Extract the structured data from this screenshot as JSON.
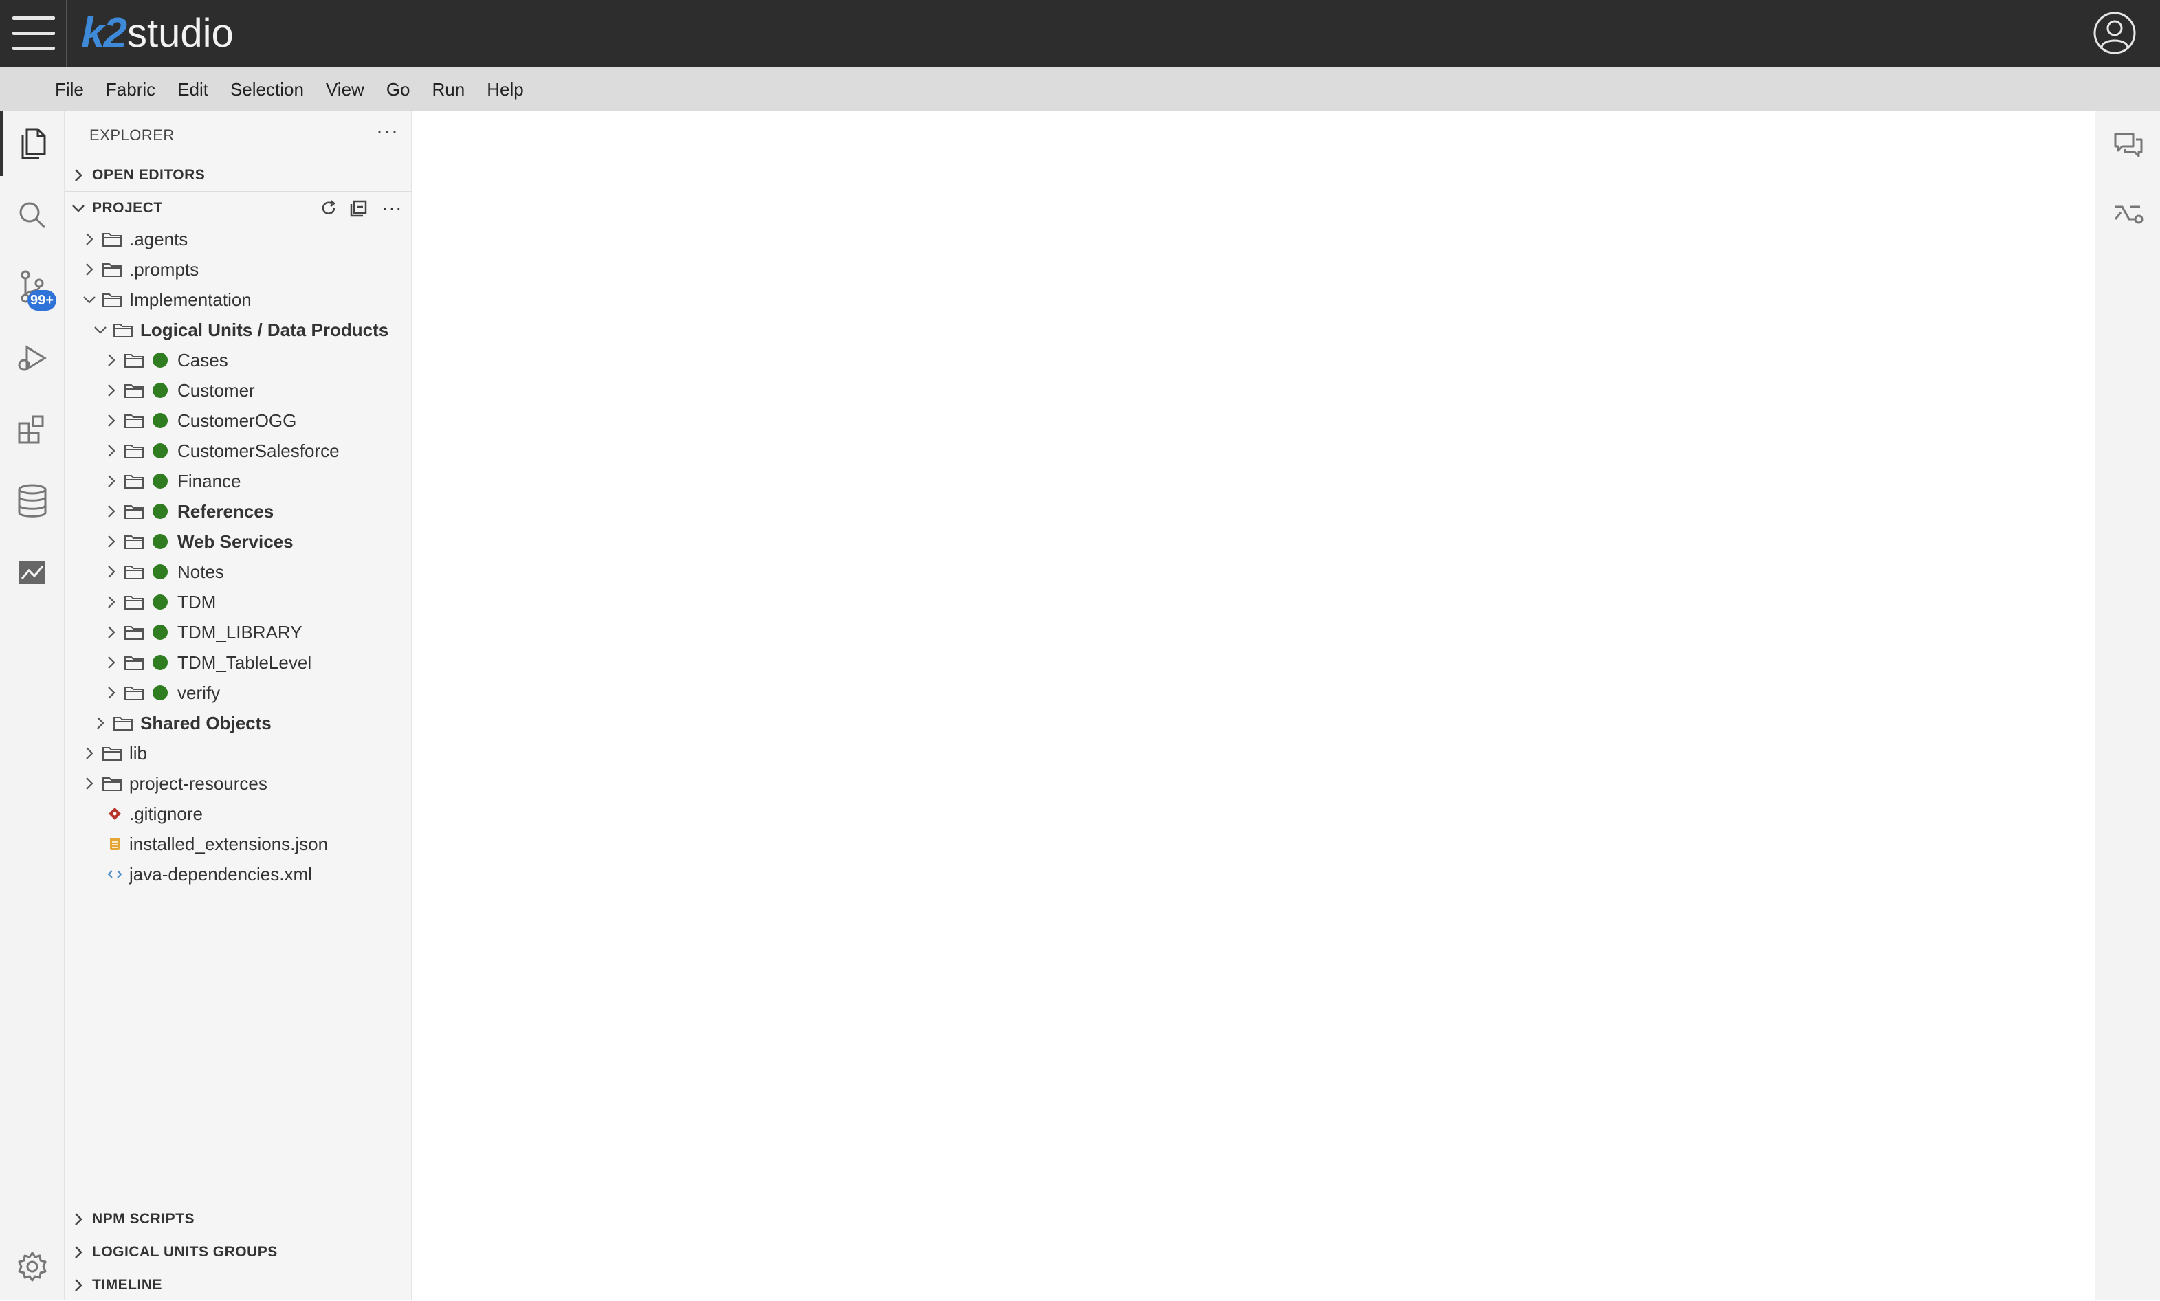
{
  "app": {
    "logo_k2": "k2",
    "logo_studio": "studio"
  },
  "menu": [
    "File",
    "Fabric",
    "Edit",
    "Selection",
    "View",
    "Go",
    "Run",
    "Help"
  ],
  "activity": {
    "source_control_badge": "99+"
  },
  "sidebar": {
    "title": "EXPLORER",
    "more": "···",
    "sections": {
      "open_editors": "OPEN EDITORS",
      "project": "PROJECT",
      "npm_scripts": "NPM SCRIPTS",
      "lu_groups": "LOGICAL UNITS GROUPS",
      "timeline": "TIMELINE"
    },
    "tree": [
      {
        "label": ".agents"
      },
      {
        "label": ".prompts"
      },
      {
        "label": "Implementation"
      },
      {
        "label": "Logical Units / Data Products"
      },
      {
        "label": "Cases"
      },
      {
        "label": "Customer"
      },
      {
        "label": "CustomerOGG"
      },
      {
        "label": "CustomerSalesforce"
      },
      {
        "label": "Finance"
      },
      {
        "label": "References"
      },
      {
        "label": "Web Services"
      },
      {
        "label": "Notes"
      },
      {
        "label": "TDM"
      },
      {
        "label": "TDM_LIBRARY"
      },
      {
        "label": "TDM_TableLevel"
      },
      {
        "label": "verify"
      },
      {
        "label": "Shared Objects"
      },
      {
        "label": "lib"
      },
      {
        "label": "project-resources"
      },
      {
        "label": ".gitignore"
      },
      {
        "label": "installed_extensions.json"
      },
      {
        "label": "java-dependencies.xml"
      }
    ]
  },
  "colors": {
    "accent": "#3f8ad8",
    "badge": "#2f73d8",
    "lu_dot": "#2f7d20",
    "topbar": "#2d2d2d"
  }
}
